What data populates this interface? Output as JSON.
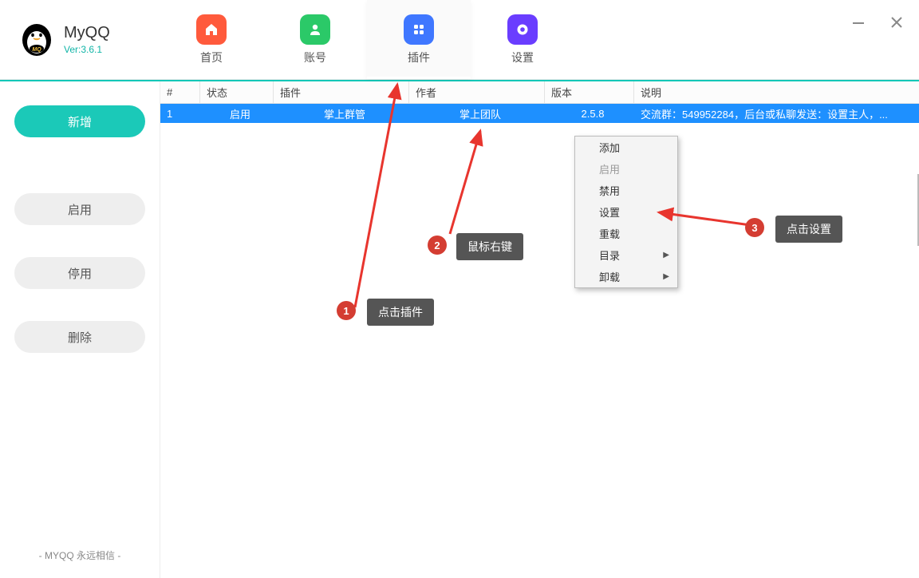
{
  "app": {
    "title": "MyQQ",
    "version": "Ver:3.6.1"
  },
  "nav": {
    "home": "首页",
    "account": "账号",
    "plugin": "插件",
    "settings": "设置"
  },
  "sidebar": {
    "add": "新增",
    "enable": "启用",
    "stop": "停用",
    "delete": "删除",
    "footer": "- MYQQ 永远相信 -"
  },
  "table": {
    "headers": {
      "idx": "#",
      "status": "状态",
      "plugin": "插件",
      "author": "作者",
      "version": "版本",
      "desc": "说明"
    },
    "row1": {
      "idx": "1",
      "status": "启用",
      "plugin": "掌上群管",
      "author": "掌上团队",
      "version": "2.5.8",
      "desc": "交流群：549952284，后台或私聊发送：设置主人，..."
    }
  },
  "context_menu": {
    "add": "添加",
    "enable": "启用",
    "disable": "禁用",
    "settings": "设置",
    "reload": "重载",
    "directory": "目录",
    "uninstall": "卸载"
  },
  "annotations": {
    "step1": {
      "num": "1",
      "label": "点击插件"
    },
    "step2": {
      "num": "2",
      "label": "鼠标右键"
    },
    "step3": {
      "num": "3",
      "label": "点击设置"
    }
  }
}
